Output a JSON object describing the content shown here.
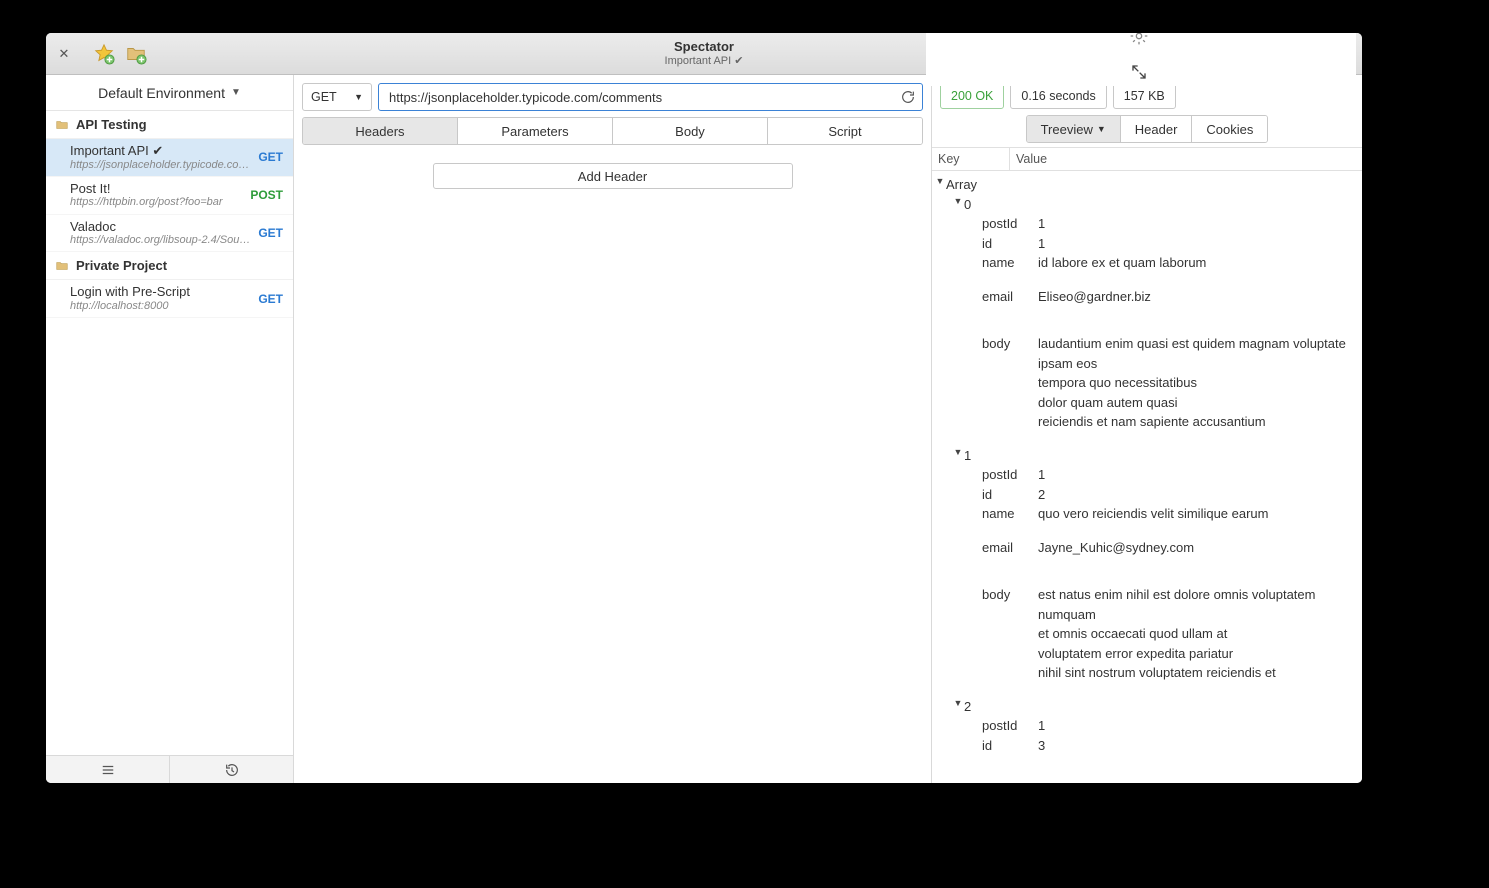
{
  "titlebar": {
    "app_name": "Spectator",
    "subtitle": "Important API ✔"
  },
  "sidebar": {
    "environment_label": "Default Environment",
    "folders": [
      {
        "name": "API Testing",
        "requests": [
          {
            "name": "Important API ✔",
            "url": "https://jsonplaceholder.typicode.co…",
            "method": "GET",
            "method_class": "method-get",
            "active": true
          },
          {
            "name": "Post It!",
            "url": "https://httpbin.org/post?foo=bar",
            "method": "POST",
            "method_class": "method-post",
            "active": false
          },
          {
            "name": "Valadoc",
            "url": "https://valadoc.org/libsoup-2.4/Sou…",
            "method": "GET",
            "method_class": "method-get",
            "active": false
          }
        ]
      },
      {
        "name": "Private Project",
        "requests": [
          {
            "name": "Login with Pre-Script",
            "url": "http://localhost:8000",
            "method": "GET",
            "method_class": "method-get",
            "active": false
          }
        ]
      }
    ]
  },
  "request": {
    "method": "GET",
    "url": "https://jsonplaceholder.typicode.com/comments",
    "tabs": [
      "Headers",
      "Parameters",
      "Body",
      "Script"
    ],
    "active_tab": 0,
    "add_header_label": "Add Header"
  },
  "response": {
    "status": "200 OK",
    "time": "0.16 seconds",
    "size": "157 KB",
    "view_tabs": [
      "Treeview",
      "Header",
      "Cookies"
    ],
    "active_view": 0,
    "columns": {
      "key": "Key",
      "value": "Value"
    },
    "root_label": "Array",
    "items": [
      {
        "index": "0",
        "fields": [
          {
            "k": "postId",
            "v": "1"
          },
          {
            "k": "id",
            "v": "1"
          },
          {
            "k": "name",
            "v": "id labore ex et quam laborum"
          },
          {
            "k": "email",
            "v": "Eliseo@gardner.biz"
          },
          {
            "k": "body",
            "v": "laudantium enim quasi est quidem magnam voluptate ipsam eos\ntempora quo necessitatibus\ndolor quam autem quasi\nreiciendis et nam sapiente accusantium"
          }
        ]
      },
      {
        "index": "1",
        "fields": [
          {
            "k": "postId",
            "v": "1"
          },
          {
            "k": "id",
            "v": "2"
          },
          {
            "k": "name",
            "v": "quo vero reiciendis velit similique earum"
          },
          {
            "k": "email",
            "v": "Jayne_Kuhic@sydney.com"
          },
          {
            "k": "body",
            "v": "est natus enim nihil est dolore omnis voluptatem numquam\net omnis occaecati quod ullam at\nvoluptatem error expedita pariatur\nnihil sint nostrum voluptatem reiciendis et"
          }
        ]
      },
      {
        "index": "2",
        "fields": [
          {
            "k": "postId",
            "v": "1"
          },
          {
            "k": "id",
            "v": "3"
          }
        ]
      }
    ]
  }
}
